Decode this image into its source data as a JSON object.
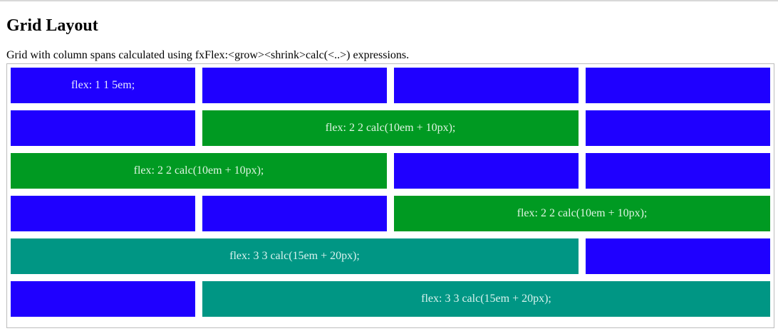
{
  "page": {
    "title": "Grid Layout",
    "description": "Grid with column spans calculated using fxFlex:<grow><shrink>calc(<..>) expressions."
  },
  "grid": {
    "rows": [
      [
        "flex: 1 1 5em;",
        "",
        "",
        ""
      ],
      [
        "",
        "flex: 2 2 calc(10em + 10px);",
        ""
      ],
      [
        "flex: 2 2 calc(10em + 10px);",
        "",
        ""
      ],
      [
        "",
        "",
        "flex: 2 2 calc(10em + 10px);"
      ],
      [
        "flex: 3 3 calc(15em + 20px);",
        ""
      ],
      [
        "",
        "flex: 3 3 calc(15em + 20px);"
      ]
    ]
  },
  "colors": {
    "blue": "#1f00ff",
    "green": "#009a22",
    "teal": "#009684"
  }
}
